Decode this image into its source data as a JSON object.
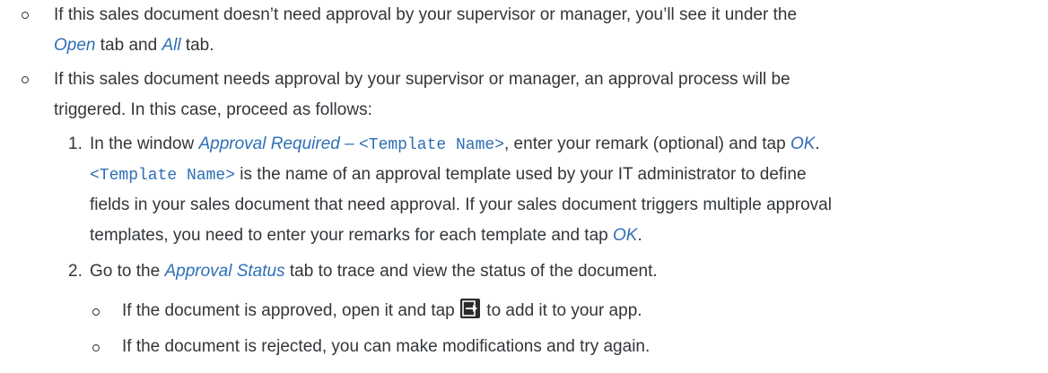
{
  "outer_bullets": [
    {
      "line1": "If this sales document doesn’t need approval by your supervisor or manager, you’ll see it under the",
      "line2": {
        "open_tab": "Open",
        "text_a": " tab and ",
        "all_tab": "All",
        "text_b": " tab."
      }
    },
    {
      "line1": "If this sales document needs approval by your supervisor or manager, an approval process will be",
      "line2": "triggered. In this case, proceed as follows:"
    }
  ],
  "steps": [
    {
      "number": "1.",
      "line1": {
        "text_a": "In the window ",
        "window_name": "Approval Required – ",
        "template_placeholder": "<Template Name>",
        "text_b": ", enter your remark (optional) and tap ",
        "ok_button": "OK",
        "text_c": "."
      },
      "line2": {
        "template_placeholder": "<Template Name>",
        "text": " is the name of an approval template used by your IT administrator to define"
      },
      "line3": "fields in your sales document that need approval. If your sales document triggers multiple approval",
      "line4": {
        "text_a": "templates, you need to enter your remarks for each template and tap ",
        "ok_button": "OK",
        "text_b": "."
      }
    },
    {
      "number": "2.",
      "line1": {
        "text_a": "Go to the ",
        "tab_name": "Approval Status",
        "text_b": " tab to trace and view the status of the document."
      }
    }
  ],
  "sub_bullets": [
    {
      "text_a": "If the document is approved, open it and tap ",
      "icon": "add-to-app-icon",
      "text_b": " to add it to your app."
    },
    {
      "text": "If the document is rejected, you can make modifications and try again."
    }
  ],
  "colors": {
    "text": "#32363a",
    "ui_term": "#2f6fb5",
    "icon_bg": "#2b2b2b"
  }
}
